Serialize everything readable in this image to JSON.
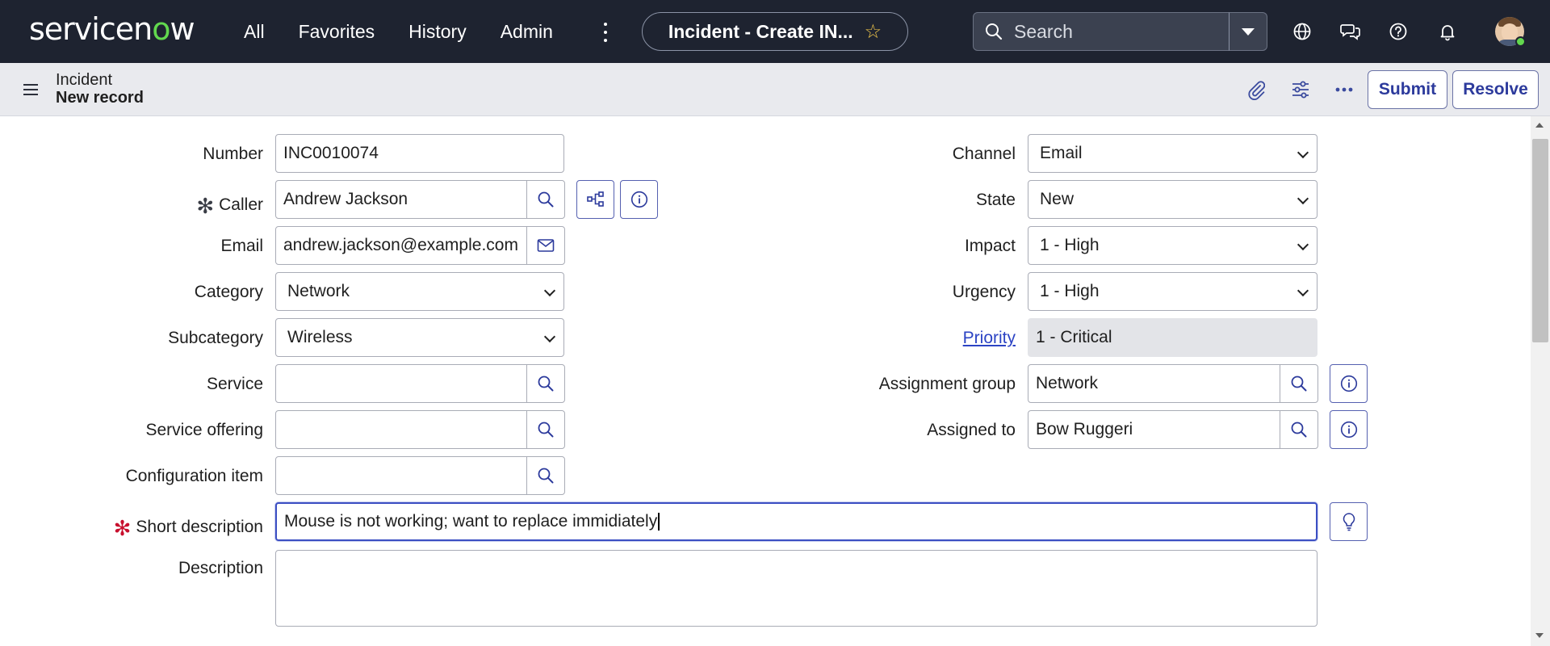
{
  "nav": {
    "logo": "servicenow",
    "links": [
      "All",
      "Favorites",
      "History",
      "Admin"
    ],
    "context_title": "Incident - Create IN...",
    "search_placeholder": "Search",
    "icons": [
      "globe-icon",
      "chat-icon",
      "help-icon",
      "bell-icon"
    ]
  },
  "record": {
    "table": "Incident",
    "subtitle": "New record",
    "buttons": {
      "submit": "Submit",
      "resolve": "Resolve"
    }
  },
  "form": {
    "number": {
      "label": "Number",
      "value": "INC0010074"
    },
    "caller": {
      "label": "Caller",
      "value": "Andrew Jackson",
      "mandatory_marker": "✻"
    },
    "email": {
      "label": "Email",
      "value": "andrew.jackson@example.com"
    },
    "category": {
      "label": "Category",
      "value": "Network"
    },
    "subcategory": {
      "label": "Subcategory",
      "value": "Wireless"
    },
    "service": {
      "label": "Service",
      "value": ""
    },
    "service_offering": {
      "label": "Service offering",
      "value": ""
    },
    "configuration_item": {
      "label": "Configuration item",
      "value": ""
    },
    "short_description": {
      "label": "Short description",
      "value": "Mouse is not working; want to replace immidiately",
      "mandatory_marker": "✻"
    },
    "description": {
      "label": "Description",
      "value": ""
    },
    "channel": {
      "label": "Channel",
      "value": "Email"
    },
    "state": {
      "label": "State",
      "value": "New"
    },
    "impact": {
      "label": "Impact",
      "value": "1 - High"
    },
    "urgency": {
      "label": "Urgency",
      "value": "1 - High"
    },
    "priority": {
      "label": "Priority",
      "value": "1 - Critical"
    },
    "assignment_group": {
      "label": "Assignment group",
      "value": "Network"
    },
    "assigned_to": {
      "label": "Assigned to",
      "value": "Bow Ruggeri"
    }
  },
  "colors": {
    "nav_bg": "#1e2330",
    "accent": "#2c3a9c",
    "mandatory": "#c8102e",
    "logo_accent": "#62d84e"
  }
}
